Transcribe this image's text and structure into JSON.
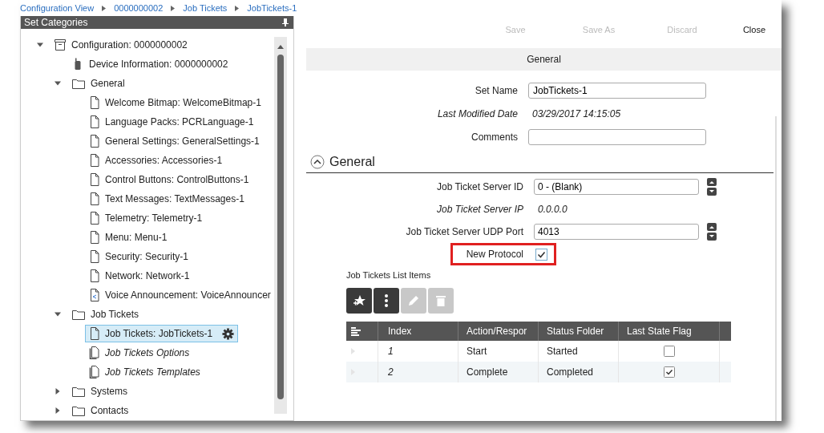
{
  "breadcrumb": [
    "Configuration View",
    "0000000002",
    "Job Tickets",
    "JobTickets-1"
  ],
  "sidebar": {
    "title": "Set Categories",
    "tree": [
      {
        "label": "Configuration: 0000000002",
        "kind": "archive",
        "expanded": true,
        "selected": false,
        "children": [
          {
            "label": "Device Information: 0000000002",
            "kind": "device",
            "selected": false
          },
          {
            "label": "General",
            "kind": "folder",
            "expanded": true,
            "selected": false,
            "children": [
              {
                "label": "Welcome Bitmap: WelcomeBitmap-1",
                "kind": "doc",
                "selected": false
              },
              {
                "label": "Language Packs: PCRLanguage-1",
                "kind": "doc",
                "selected": false
              },
              {
                "label": "General Settings: GeneralSettings-1",
                "kind": "doc",
                "selected": false
              },
              {
                "label": "Accessories: Accessories-1",
                "kind": "doc",
                "selected": false
              },
              {
                "label": "Control Buttons: ControlButtons-1",
                "kind": "doc",
                "selected": false
              },
              {
                "label": "Text Messages: TextMessages-1",
                "kind": "doc",
                "selected": false
              },
              {
                "label": "Telemetry: Telemetry-1",
                "kind": "doc",
                "selected": false
              },
              {
                "label": "Menu: Menu-1",
                "kind": "doc",
                "selected": false
              },
              {
                "label": "Security: Security-1",
                "kind": "doc",
                "selected": false
              },
              {
                "label": "Network: Network-1",
                "kind": "doc",
                "selected": false
              },
              {
                "label": "Voice Announcement: VoiceAnnouncer",
                "kind": "shared-doc",
                "selected": false
              }
            ]
          },
          {
            "label": "Job Tickets",
            "kind": "folder",
            "expanded": true,
            "selected": false,
            "children": [
              {
                "label": "Job Tickets: JobTickets-1",
                "kind": "doc",
                "selected": true
              },
              {
                "label": "Job Tickets Options",
                "kind": "stacked-doc",
                "selected": false
              },
              {
                "label": "Job Tickets Templates",
                "kind": "stacked-doc",
                "selected": false
              }
            ]
          },
          {
            "label": "Systems",
            "kind": "folder",
            "expanded": false,
            "selected": false
          },
          {
            "label": "Contacts",
            "kind": "folder",
            "expanded": false,
            "selected": false
          }
        ]
      }
    ]
  },
  "toolbar": [
    {
      "label": "Save",
      "disabled": true
    },
    {
      "label": "Save As",
      "disabled": true
    },
    {
      "label": "Discard",
      "disabled": true
    },
    {
      "label": "Close",
      "disabled": false
    }
  ],
  "tab": "General",
  "set_fields": [
    {
      "kind": "input",
      "label": "Set Name",
      "value": "JobTickets-1"
    },
    {
      "kind": "readonly",
      "label": "Last Modified Date",
      "value": "03/29/2017 14:15:05"
    },
    {
      "kind": "input",
      "label": "Comments"
    }
  ],
  "section": {
    "title": "General",
    "expanded": true,
    "fields": [
      {
        "kind": "spinner",
        "label": "Job Ticket Server ID",
        "value": "0 - (Blank)",
        "highlighted": false
      },
      {
        "kind": "readonly",
        "label": "Job Ticket Server IP",
        "value": "0.0.0.0",
        "highlighted": false
      },
      {
        "kind": "spinner",
        "label": "Job Ticket Server UDP Port",
        "value": "4013",
        "highlighted": false
      },
      {
        "kind": "checkbox",
        "label": "New Protocol",
        "checked": true,
        "highlighted": true
      }
    ]
  },
  "list": {
    "title": "Job Tickets List Items",
    "buttons": [
      {
        "kind": "add",
        "disabled": false
      },
      {
        "kind": "more",
        "disabled": false
      },
      {
        "kind": "edit",
        "disabled": true
      },
      {
        "kind": "delete",
        "disabled": true
      }
    ],
    "columns": [
      "Index",
      "Action/Respor",
      "Status Folder",
      "Last State Flag"
    ],
    "rows": [
      {
        "index": "1",
        "action": "Start",
        "status": "Started",
        "last_state": false,
        "selected": false
      },
      {
        "index": "2",
        "action": "Complete",
        "status": "Completed",
        "last_state": true,
        "selected": true
      }
    ]
  }
}
